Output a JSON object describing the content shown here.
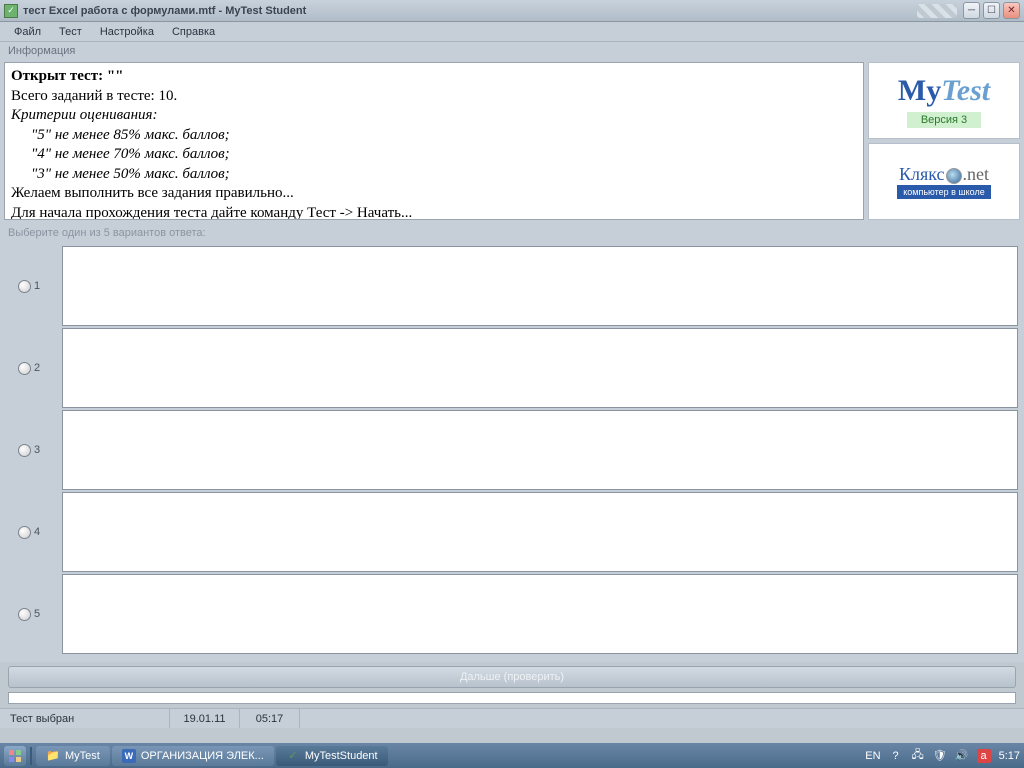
{
  "window": {
    "title": "тест Excel работа с формулами.mtf - MyTest Student"
  },
  "menu": {
    "file": "Файл",
    "test": "Тест",
    "settings": "Настройка",
    "help": "Справка"
  },
  "labels": {
    "info": "Информация",
    "choose": "Выберите один из 5 вариантов ответа:"
  },
  "info": {
    "line1_prefix": "Открыт тест: ",
    "line1_name": "\"\"",
    "line2": "Всего заданий в тесте: 10.",
    "criteria_header": "Критерии оценивания:",
    "crit5": "\"5\" не менее 85% макс. баллов;",
    "crit4": "\"4\" не менее 70% макс. баллов;",
    "crit3": "\"3\" не менее 50% макс. баллов;",
    "wish": "Желаем выполнить все задания правильно...",
    "start_hint": "Для начала прохождения теста дайте команду Тест -> Начать..."
  },
  "logo": {
    "my": "My",
    "test": "Test",
    "version": "Версия 3",
    "klyakso": "Клякс",
    "klyakso_net": ".net",
    "klyakso_sub": "компьютер в школе"
  },
  "answers": {
    "n1": "1",
    "n2": "2",
    "n3": "3",
    "n4": "4",
    "n5": "5"
  },
  "buttons": {
    "next": "Дальше (проверить)"
  },
  "status": {
    "test_selected": "Тест выбран",
    "date": "19.01.11",
    "time": "05:17"
  },
  "taskbar": {
    "t1": "MyTest",
    "t2": "ОРГАНИЗАЦИЯ ЭЛЕК...",
    "t3": "MyTestStudent",
    "lang": "EN",
    "clock": "5:17"
  }
}
